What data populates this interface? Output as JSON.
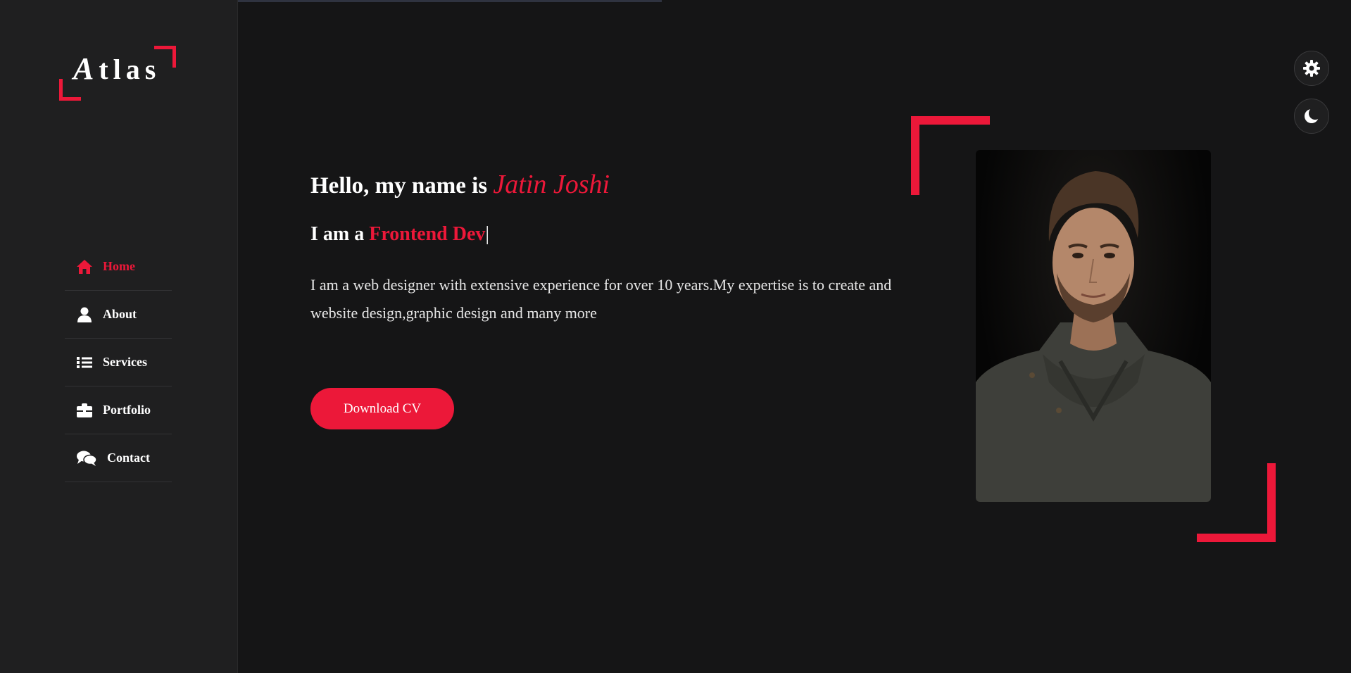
{
  "logo": {
    "initial": "A",
    "rest": "tlas"
  },
  "nav": [
    {
      "label": "Home",
      "icon": "home-icon",
      "active": true
    },
    {
      "label": "About",
      "icon": "user-icon",
      "active": false
    },
    {
      "label": "Services",
      "icon": "list-icon",
      "active": false
    },
    {
      "label": "Portfolio",
      "icon": "briefcase-icon",
      "active": false
    },
    {
      "label": "Contact",
      "icon": "comments-icon",
      "active": false
    }
  ],
  "hero": {
    "greeting": "Hello, my name is ",
    "name": "Jatin Joshi",
    "iam_prefix": "I am a ",
    "role": "Frontend Dev",
    "cursor": "|",
    "description": "I am a web designer with extensive experience for over 10 years.My expertise is to create and website design,graphic design and many more",
    "cv_button": "Download CV"
  },
  "tools": {
    "settings_icon": "gear-icon",
    "theme_icon": "moon-icon"
  },
  "colors": {
    "accent": "#ec1839",
    "background": "#151516",
    "sidebar": "#1f1f20",
    "text": "#ffffff"
  }
}
